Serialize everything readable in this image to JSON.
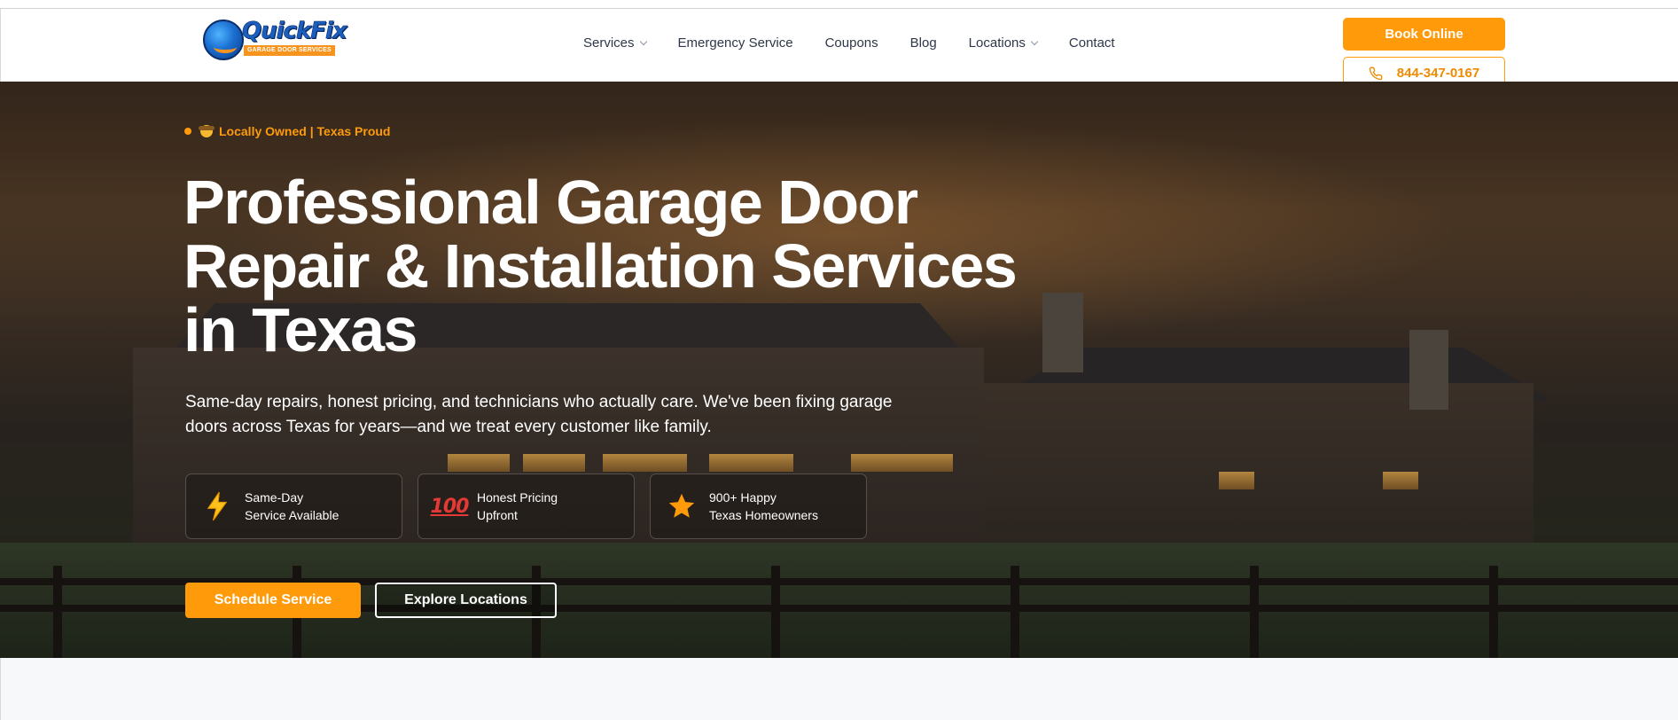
{
  "header": {
    "logo": {
      "name": "QuickFix",
      "tagline": "GARAGE DOOR SERVICES"
    },
    "nav": [
      {
        "label": "Services",
        "has_dropdown": true
      },
      {
        "label": "Emergency Service",
        "has_dropdown": false
      },
      {
        "label": "Coupons",
        "has_dropdown": false
      },
      {
        "label": "Blog",
        "has_dropdown": false
      },
      {
        "label": "Locations",
        "has_dropdown": true
      },
      {
        "label": "Contact",
        "has_dropdown": false
      }
    ],
    "book_label": "Book Online",
    "phone_label": "844-347-0167",
    "phone_icon": "phone-icon"
  },
  "hero": {
    "badge": "Locally Owned | Texas Proud",
    "badge_emoji": "cowboy-hat-face-icon",
    "headline_lines": [
      "Professional Garage Door",
      "Repair & Installation Services",
      "in Texas"
    ],
    "subtext": "Same-day repairs, honest pricing, and technicians who actually care. We've been fixing garage doors across Texas for years—and we treat every customer like family.",
    "features": [
      {
        "icon": "lightning-icon",
        "line1": "Same-Day",
        "line2": "Service Available"
      },
      {
        "icon": "hundred-points-icon",
        "line1": "Honest Pricing",
        "line2": "Upfront"
      },
      {
        "icon": "star-icon",
        "line1": "900+ Happy",
        "line2": "Texas Homeowners"
      }
    ],
    "cta_primary": "Schedule Service",
    "cta_secondary": "Explore Locations"
  },
  "colors": {
    "accent": "#ff9a0a",
    "text_dark": "#2d3748",
    "white": "#ffffff"
  }
}
